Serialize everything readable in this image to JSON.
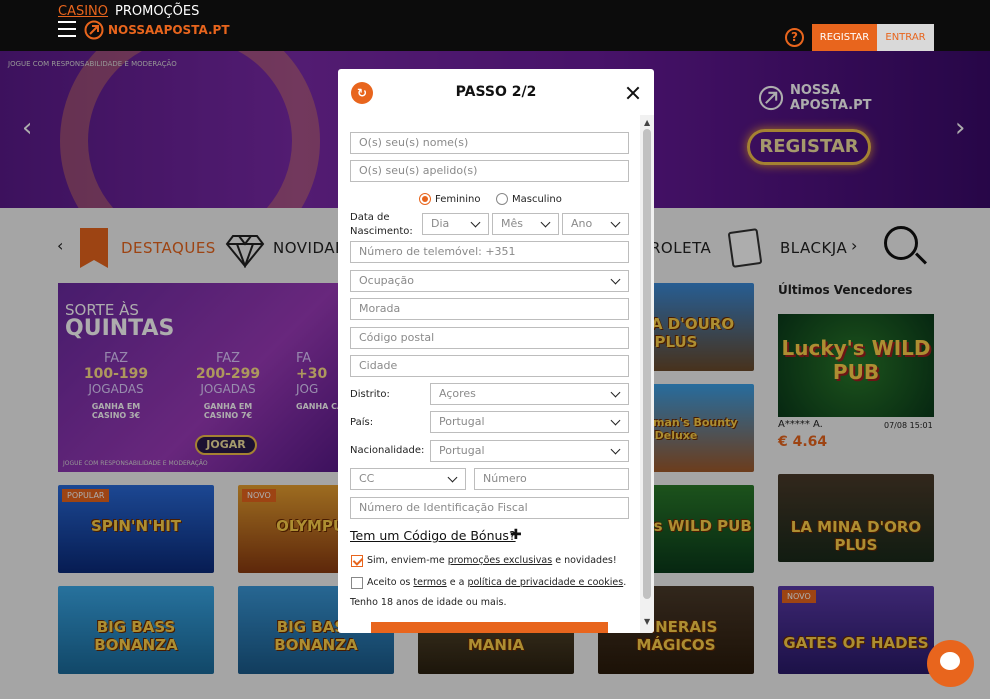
{
  "topbar": {
    "nav_casino": "CASINO",
    "nav_promocoes": "PROMOÇÕES",
    "logo": "NOSSAAPOSTA.PT",
    "help": "?",
    "registar": "REGISTAR",
    "entrar": "ENTRAR"
  },
  "hero": {
    "responsible": "JOGUE COM RESPONSABILIDADE E MODERAÇÃO",
    "logo_line1": "NOSSA",
    "logo_line2": "APOSTA.PT",
    "cta": "REGISTAR",
    "arrow_left": "‹",
    "arrow_right": "›"
  },
  "categories": {
    "prev": "‹",
    "next": "›",
    "destaques": "DESTAQUES",
    "novidades": "NOVIDADES",
    "roleta": "ROLETA",
    "blackjack": "BLACKJA"
  },
  "promo": {
    "title1": "SORTE ÀS",
    "title2": "QUINTAS",
    "cols": [
      {
        "faz": "FAZ",
        "range": "100-199",
        "jog": "JOGADAS",
        "ganha": "GANHA EM CASINO 3€"
      },
      {
        "faz": "FAZ",
        "range": "200-299",
        "jog": "JOGADAS",
        "ganha": "GANHA EM CASINO 7€"
      },
      {
        "faz": "FA",
        "range": "+30",
        "jog": "JOG",
        "ganha": "GANHA CASIN"
      }
    ],
    "jogar": "JOGAR",
    "responsible": "JOGUE COM RESPONSABILIDADE E MODERAÇÃO"
  },
  "games": {
    "spin_hit": {
      "name": "SPIN'N'HIT",
      "badge": "POPULAR"
    },
    "olympus": {
      "name": "OLYMPUS",
      "badge": "NOVO"
    },
    "mina_ouro": {
      "name": "MINA D'OURO PLUS"
    },
    "fisherman": {
      "name": "Fisherman's Bounty Deluxe"
    },
    "luckys_wild": {
      "name": "Lucky's WILD PUB"
    },
    "big_bass": {
      "name": "BIG BASS BONANZA"
    },
    "big_bass2": {
      "name": "BIG BASS BONANZA"
    },
    "mina_ouro_mania": {
      "name": "MINA D'OURO MANIA"
    },
    "minerais": {
      "name": "MINERAIS MÁGICOS"
    },
    "la_mina": {
      "name": "LA MINA D'ORO PLUS"
    },
    "gates_hades": {
      "name": "GATES OF HADES",
      "badge": "NOVO"
    }
  },
  "winners": {
    "title": "Últimos Vencedores",
    "card_game": "Lucky's WILD PUB",
    "user": "A***** A.",
    "time": "07/08 15:01",
    "amount": "€ 4.64"
  },
  "modal": {
    "title": "PASSO 2/2",
    "first_name_placeholder": "O(s) seu(s) nome(s)",
    "last_name_placeholder": "O(s) seu(s) apelido(s)",
    "gender_female": "Feminino",
    "gender_male": "Masculino",
    "birth_label": "Data de Nascimento:",
    "day": "Dia",
    "month": "Mês",
    "year": "Ano",
    "phone_placeholder": "Número de telemóvel: +351",
    "occupation": "Ocupação",
    "address_placeholder": "Morada",
    "postal_placeholder": "Código postal",
    "city_placeholder": "Cidade",
    "district_label": "Distrito:",
    "district_value": "Açores",
    "country_label": "País:",
    "country_value": "Portugal",
    "nationality_label": "Nacionalidade:",
    "nationality_value": "Portugal",
    "doc_type": "CC",
    "doc_number_placeholder": "Número",
    "nif_placeholder": "Número de Identificação Fiscal",
    "bonus_link": "Tem um Código de Bónus?",
    "bonus_plus": "✚",
    "promo_check_pre": "Sim, enviem-me ",
    "promo_check_link": "promoções exclusivas",
    "promo_check_post": " e novidades!",
    "terms_pre": "Aceito os ",
    "terms_link": "termos",
    "terms_mid": " e a ",
    "privacy_link": "política de privacidade e cookies",
    "terms_post": ".",
    "age_text": "Tenho 18 anos de idade ou mais."
  }
}
